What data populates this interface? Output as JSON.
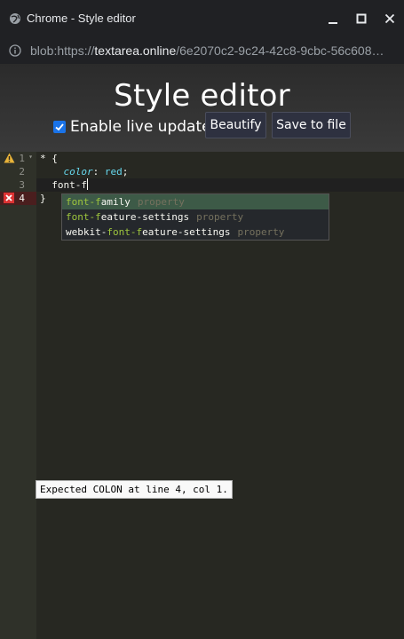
{
  "window": {
    "title": "Chrome - Style editor",
    "controls": [
      "minimize",
      "maximize",
      "close"
    ]
  },
  "urlbar": {
    "scheme": "blob:https://",
    "host": "textarea.online",
    "path": "/6e2070c2-9c24-42c8-9cbc-56c608…"
  },
  "header": {
    "title": "Style editor",
    "live_update_label": "Enable live update",
    "live_update_checked": true,
    "beautify_label": "Beautify",
    "save_label": "Save to file"
  },
  "editor": {
    "lines": [
      {
        "number": "1",
        "text": "* {",
        "marker": "warning",
        "fold": true
      },
      {
        "number": "2",
        "prop": "color",
        "colon": ": ",
        "value": "red",
        "semi": ";"
      },
      {
        "number": "3",
        "text": "  font-f",
        "active": true
      },
      {
        "number": "4",
        "text": "}",
        "marker": "error"
      }
    ],
    "autocomplete": [
      {
        "match": "font-f",
        "rest": "amily",
        "meta": "property",
        "selected": true
      },
      {
        "match": "font-f",
        "rest": "eature-settings",
        "meta": "property"
      },
      {
        "prefix": "webkit-",
        "match": "font-f",
        "rest": "eature-settings",
        "meta": "property"
      }
    ],
    "tooltip": "Expected COLON at line 4, col 1."
  },
  "colors": {
    "accent": "#1a73e8",
    "editor_bg": "#272822",
    "keyword": "#66d9ef",
    "match": "#9ec63d"
  }
}
